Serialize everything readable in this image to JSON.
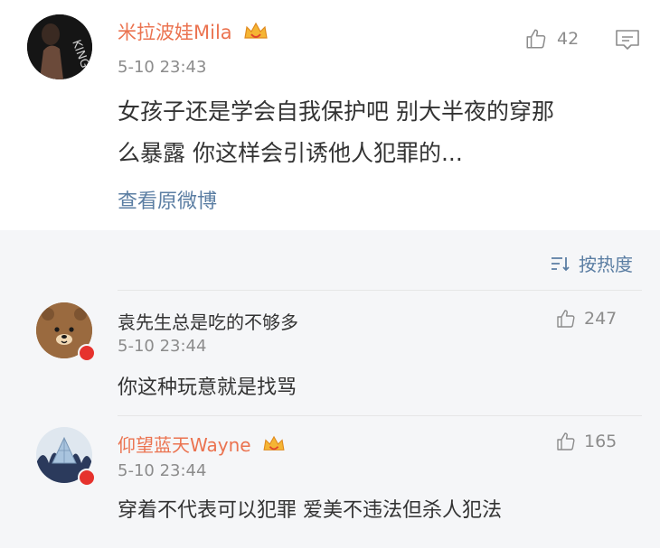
{
  "post": {
    "username": "米拉波娃Mila",
    "time": "5-10 23:43",
    "like_count": "42",
    "text_line1": "女孩子还是学会自我保护吧 别大半夜的穿那",
    "text_line2": "么暴露 你这样会引诱他人犯罪的...",
    "view_original": "查看原微博"
  },
  "sort": {
    "label": "按热度"
  },
  "comments": [
    {
      "username": "袁先生总是吃的不够多",
      "time": "5-10 23:44",
      "like_count": "247",
      "text": "你这种玩意就是找骂"
    },
    {
      "username": "仰望蓝天Wayne",
      "time": "5-10 23:44",
      "like_count": "165",
      "text": "穿着不代表可以犯罪 爱美不违法但杀人犯法"
    }
  ],
  "colors": {
    "username": "#eb7350",
    "muted": "#8c8c8c",
    "link": "#5b7ea3",
    "bg_alt": "#f5f6f8"
  }
}
